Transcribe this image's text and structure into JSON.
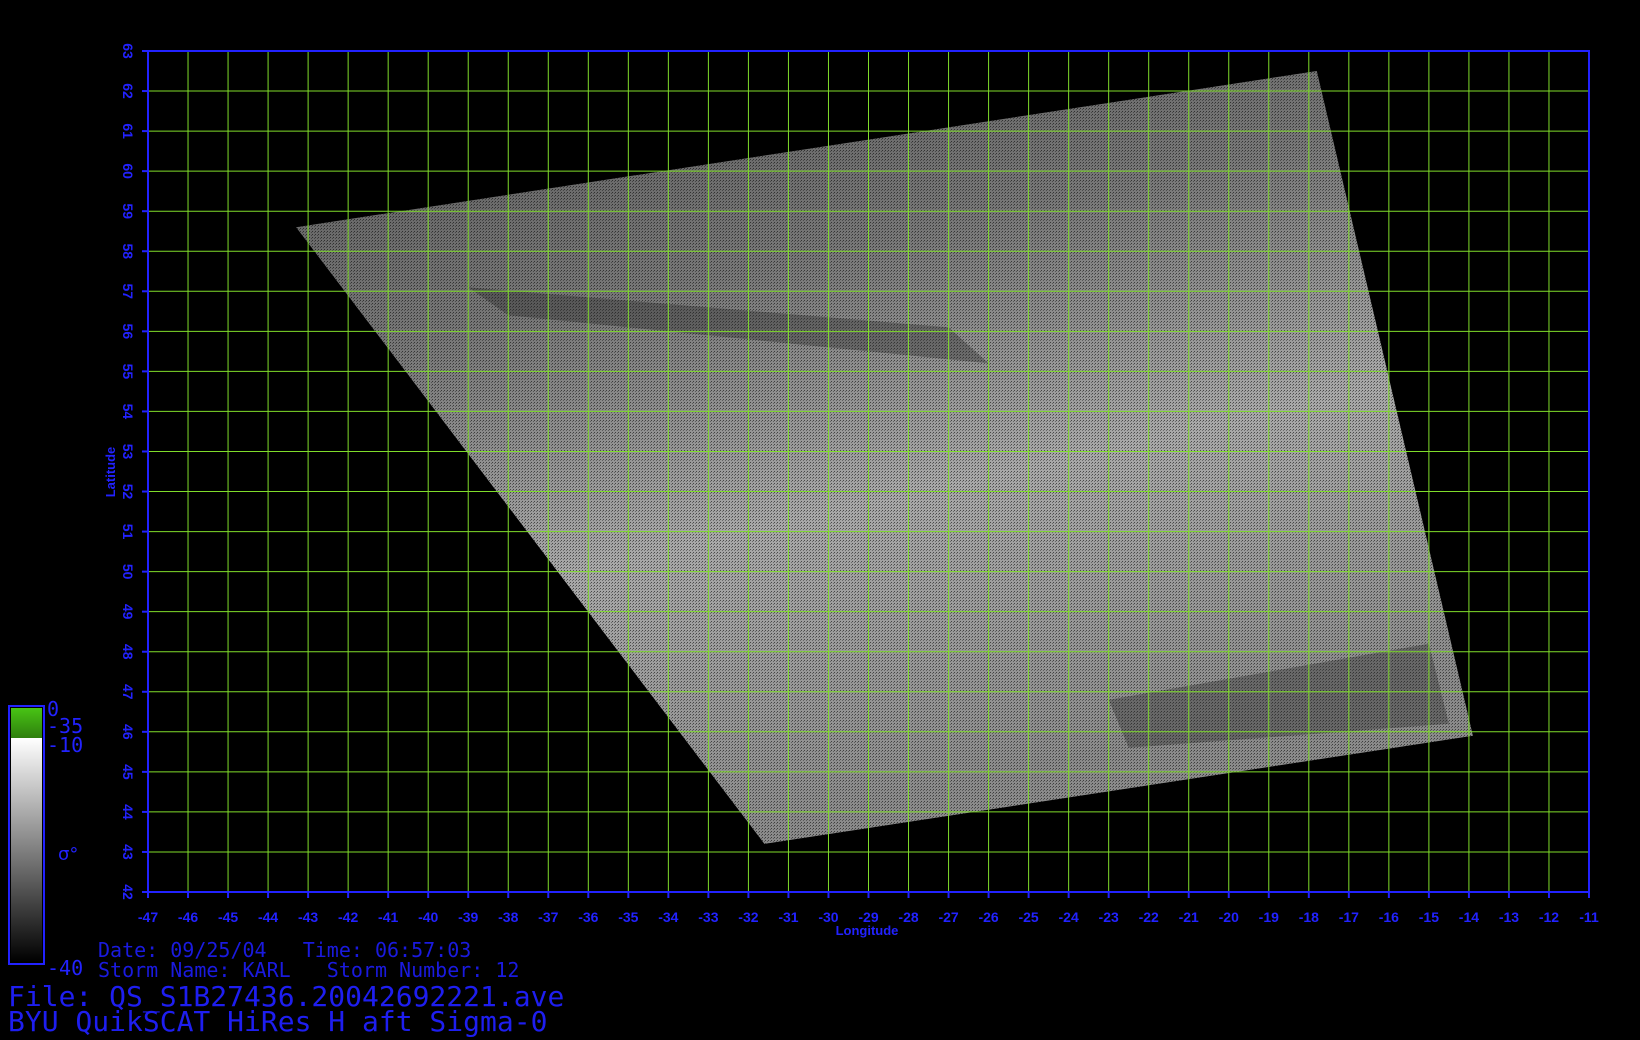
{
  "map": {
    "x_axis": {
      "label": "Longitude",
      "min": -47,
      "max": -11,
      "step": 1,
      "ticks": [
        "-47",
        "-46",
        "-45",
        "-44",
        "-43",
        "-42",
        "-41",
        "-40",
        "-39",
        "-38",
        "-37",
        "-36",
        "-35",
        "-34",
        "-33",
        "-32",
        "-31",
        "-30",
        "-29",
        "-28",
        "-27",
        "-26",
        "-25",
        "-24",
        "-23",
        "-22",
        "-21",
        "-20",
        "-19",
        "-18",
        "-17",
        "-16",
        "-15",
        "-14",
        "-13",
        "-12",
        "-11"
      ]
    },
    "y_axis": {
      "label": "Latitude",
      "min": 42,
      "max": 63,
      "step": 1,
      "ticks": [
        "42",
        "43",
        "44",
        "45",
        "46",
        "47",
        "48",
        "49",
        "50",
        "51",
        "52",
        "53",
        "54",
        "55",
        "56",
        "57",
        "58",
        "59",
        "60",
        "61",
        "62",
        "63"
      ]
    },
    "grid": true,
    "swath_corners_lonlat": [
      [
        -43.3,
        58.6
      ],
      [
        -17.8,
        62.5
      ],
      [
        -13.9,
        45.9
      ],
      [
        -31.6,
        43.2
      ]
    ],
    "colors": {
      "frame": "#2222ff",
      "grid": "#7fdc2a",
      "background": "#000000"
    }
  },
  "colorbar": {
    "labels": [
      "0",
      "-35",
      "-10",
      "-40"
    ],
    "symbol": "σ°",
    "colors": {
      "top": "#38a010",
      "bright": "#ffffff",
      "dark": "#000000"
    }
  },
  "info": {
    "date_line": "Date: 09/25/04   Time: 06:57:03",
    "storm_line": "Storm Name: KARL   Storm Number: 12",
    "file_line": "File: QS_S1B27436.20042692221.ave",
    "product_line": "BYU QuikSCAT HiRes H aft Sigma-0"
  }
}
